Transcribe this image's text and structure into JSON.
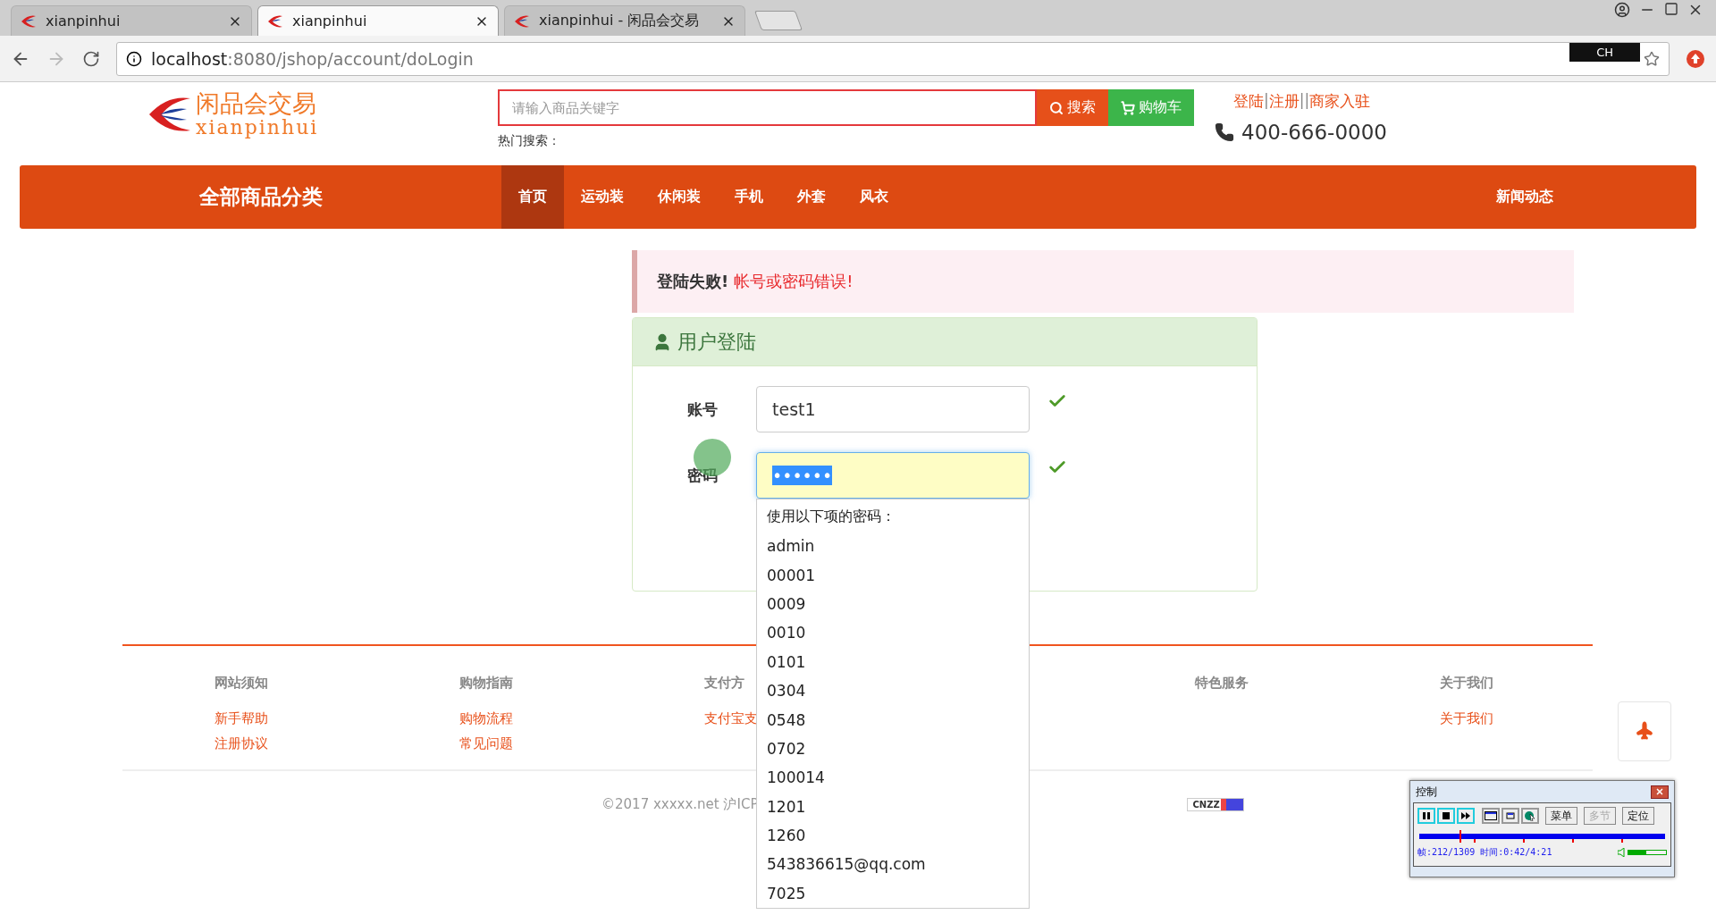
{
  "browser": {
    "tabs": [
      {
        "title": "xianpinhui",
        "selected": false
      },
      {
        "title": "xianpinhui",
        "selected": true
      },
      {
        "title": "xianpinhui - 闲品会交易",
        "selected": false
      }
    ],
    "url": {
      "host": "localhost",
      "path": ":8080/jshop/account/doLogin"
    },
    "ime": "CH"
  },
  "header": {
    "logo": {
      "name": "闲品会交易",
      "pinyin": "xianpinhui"
    },
    "search": {
      "placeholder": "请输入商品关键字",
      "button": "搜索",
      "cart": "购物车"
    },
    "hot_search": "热门搜索：",
    "account_links": [
      {
        "text": "登陆",
        "kind": "link"
      },
      {
        "text": "|",
        "kind": "separator"
      },
      {
        "text": "注册",
        "kind": "link"
      },
      {
        "text": "||",
        "kind": "separator"
      },
      {
        "text": "商家入驻",
        "kind": "link"
      }
    ],
    "phone": "400-666-0000"
  },
  "nav": {
    "category": "全部商品分类",
    "items": [
      {
        "label": "首页",
        "selected": true
      },
      {
        "label": "运动装",
        "selected": false
      },
      {
        "label": "休闲装",
        "selected": false
      },
      {
        "label": "手机",
        "selected": false
      },
      {
        "label": "外套",
        "selected": false
      },
      {
        "label": "风衣",
        "selected": false
      }
    ],
    "news": "新闻动态"
  },
  "alert": {
    "title": "登陆失败!",
    "message": "帐号或密码错误!"
  },
  "login": {
    "title": "用户登陆",
    "fields": [
      {
        "label": "账号",
        "value": "test1",
        "focused": false,
        "valid": true
      },
      {
        "label": "密码",
        "value": "••••••",
        "focused": true,
        "valid": true
      }
    ],
    "autofill": {
      "heading": "使用以下项的密码：",
      "options": [
        "admin",
        "00001",
        "0009",
        "0010",
        "0101",
        "0304",
        "0548",
        "0702",
        "100014",
        "1201",
        "1260",
        "543836615@qq.com",
        "7025"
      ]
    }
  },
  "footer": {
    "columns": [
      {
        "heading": "网站须知",
        "links": [
          "新手帮助",
          "注册协议"
        ]
      },
      {
        "heading": "购物指南",
        "links": [
          "购物流程",
          "常见问题"
        ]
      },
      {
        "heading": "支付方",
        "links": [
          "支付宝支"
        ]
      },
      {
        "heading": "特色服务"
      },
      {
        "heading": "关于我们",
        "links": [
          "关于我们"
        ]
      }
    ],
    "copyright": "©2017 xxxxx.net 沪ICP",
    "badge": "CNZZ"
  },
  "recorder": {
    "title": "控制",
    "buttons": [
      {
        "label": "菜单",
        "disabled": false
      },
      {
        "label": "多节",
        "disabled": true
      },
      {
        "label": "定位",
        "disabled": false
      }
    ],
    "progress": {
      "level": 0.162
    },
    "status": "帧:212/1309 时间:0:42/4:21",
    "volume": {
      "level": 0.48
    }
  }
}
